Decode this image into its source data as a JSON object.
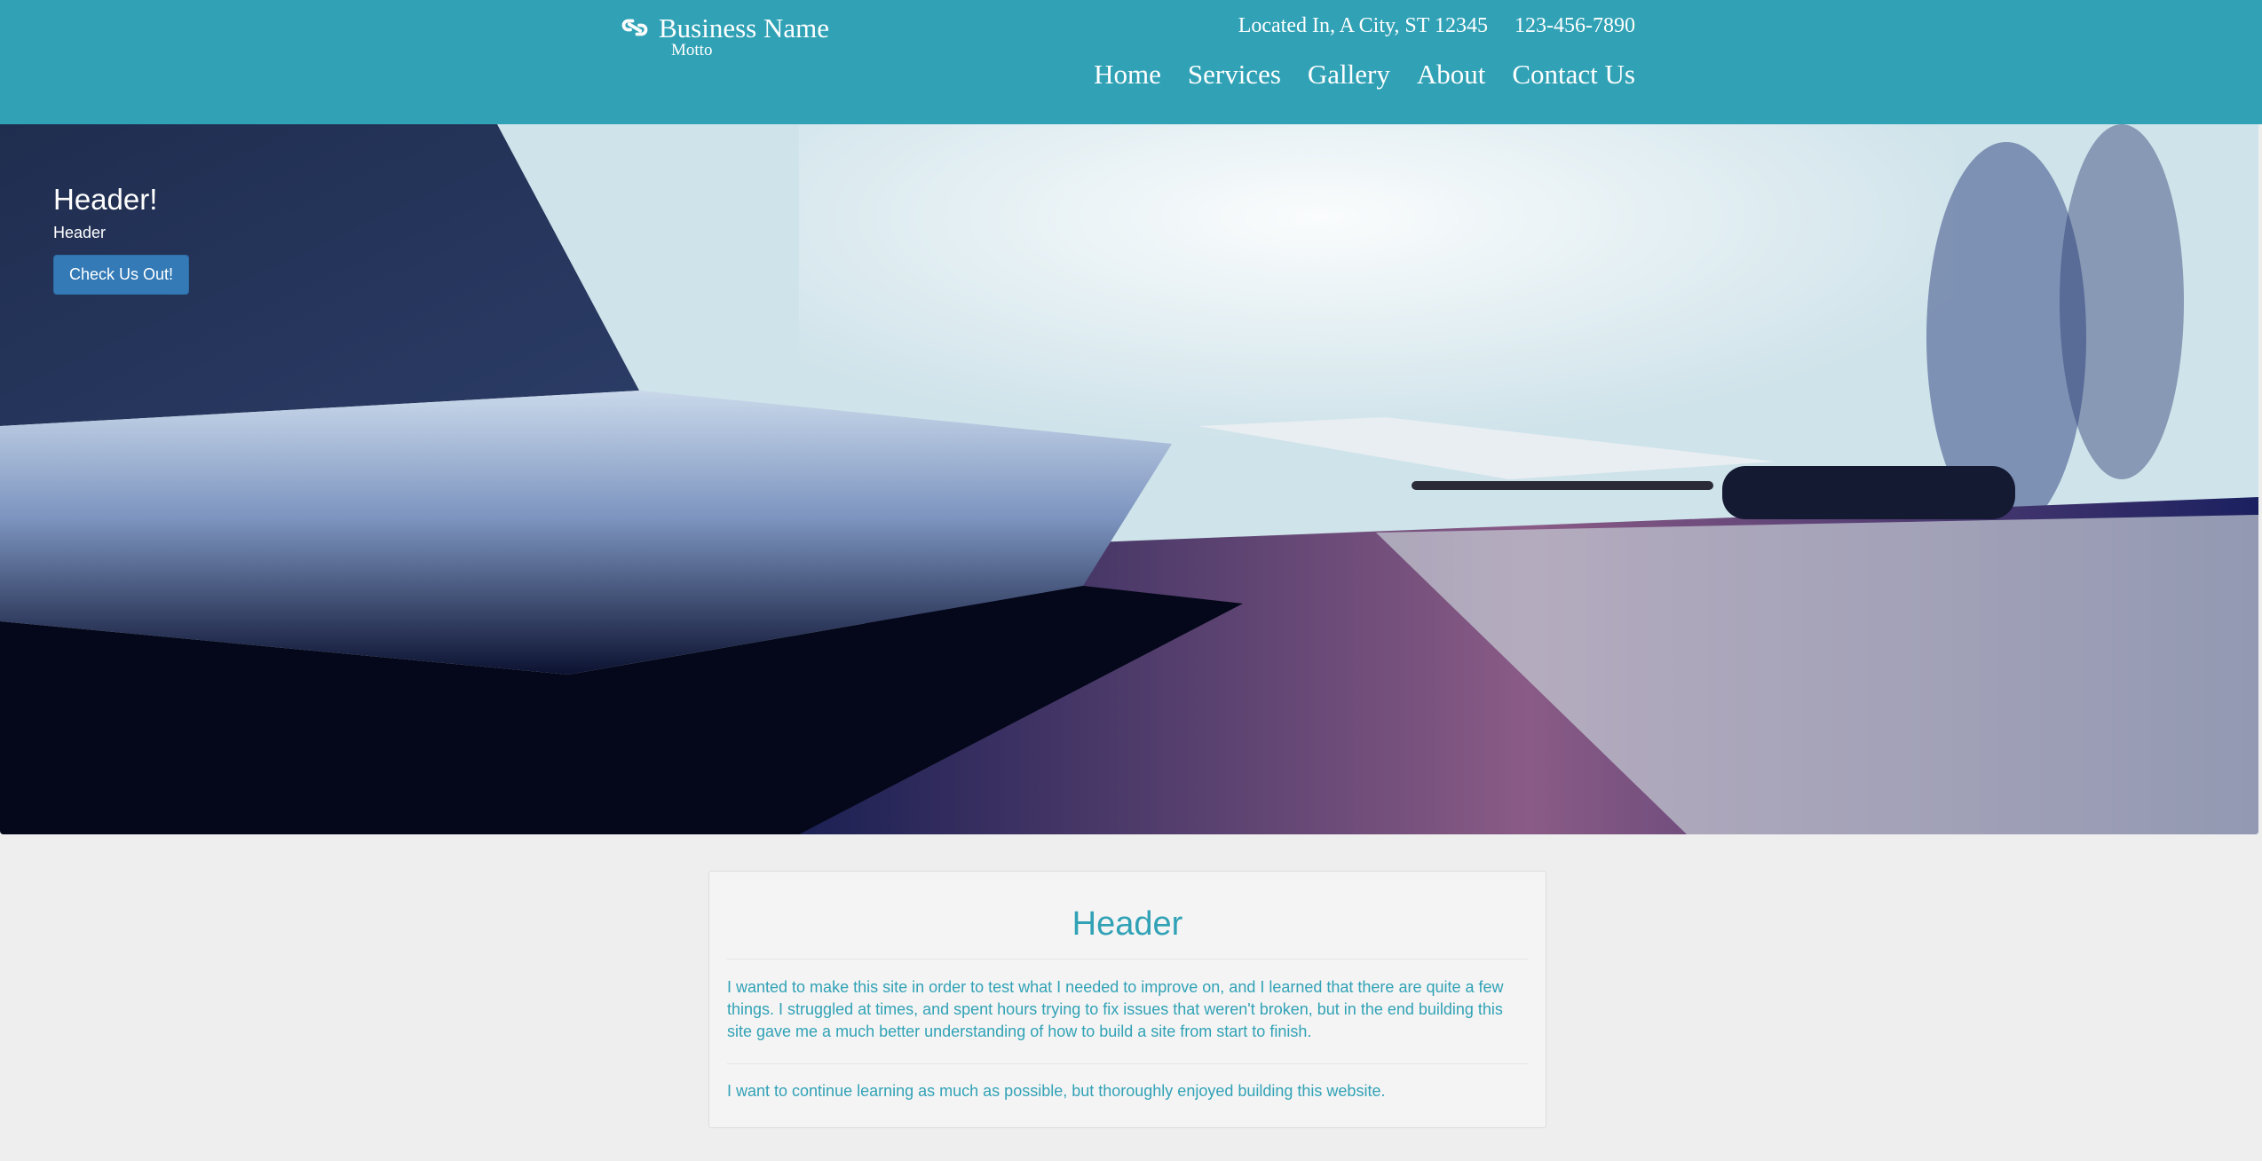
{
  "brand": {
    "name": "Business Name",
    "motto": "Motto",
    "icon": "link-icon"
  },
  "contact": {
    "location": "Located In, A City, ST 12345",
    "phone": "123-456-7890"
  },
  "nav": [
    "Home",
    "Services",
    "Gallery",
    "About",
    "Contact Us"
  ],
  "hero": {
    "title": "Header!",
    "subtitle": "Header",
    "button_label": "Check Us Out!"
  },
  "panel": {
    "title": "Header",
    "paragraphs": [
      "I wanted to make this site in order to test what I needed to improve on, and I learned that there are quite a few things. I struggled at times, and spent hours trying to fix issues that weren't broken, but in the end building this site gave me a much better understanding of how to build a site from start to finish.",
      "I want to continue learning as much as possible, but thoroughly enjoyed building this website."
    ]
  },
  "colors": {
    "navbar": "#31a2b6",
    "accent_text": "#31a2b6",
    "button": "#337ab7",
    "page_background": "#eeeeee"
  }
}
